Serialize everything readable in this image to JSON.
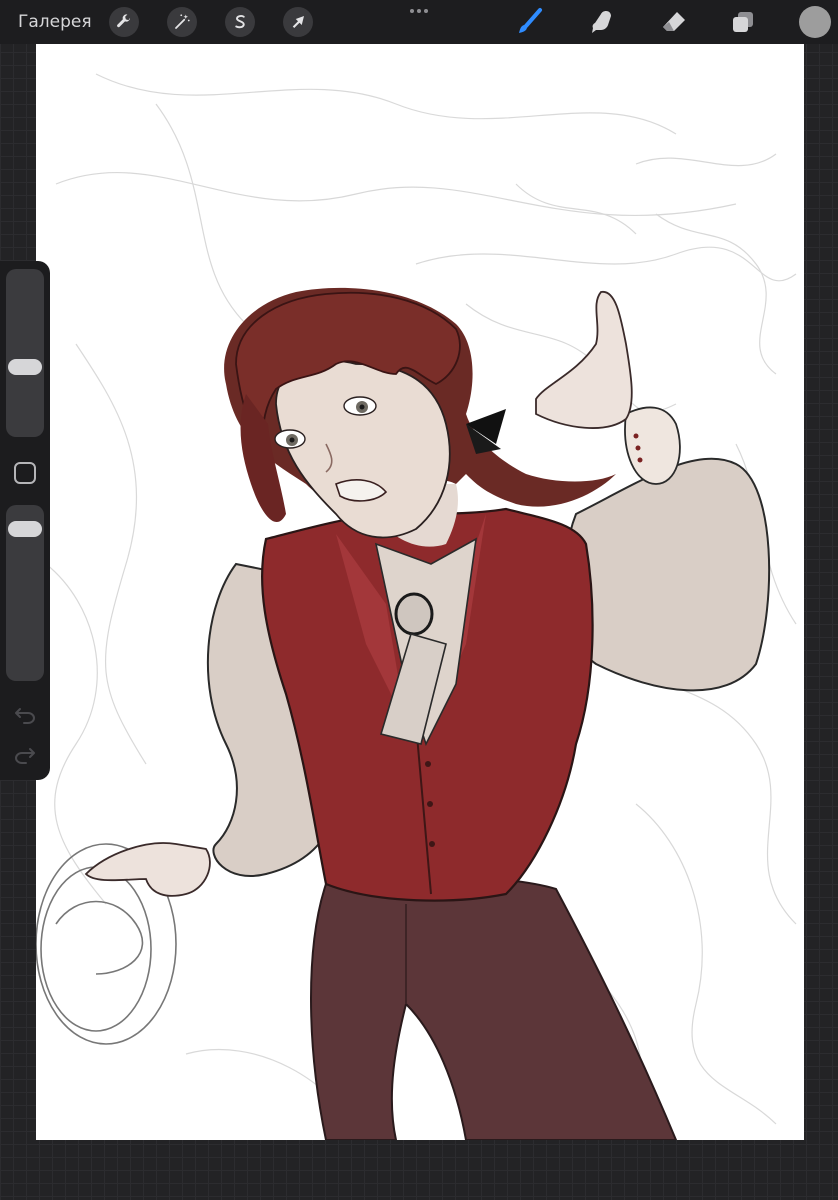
{
  "toolbar": {
    "gallery_label": "Галерея",
    "left_tools": [
      {
        "name": "actions",
        "icon": "wrench-icon"
      },
      {
        "name": "adjustments",
        "icon": "magic-wand-icon"
      },
      {
        "name": "selection",
        "icon": "selection-s-icon"
      },
      {
        "name": "transform",
        "icon": "arrow-cursor-icon"
      }
    ],
    "more_icon": "more-dots-icon",
    "right_tools": [
      {
        "name": "brush",
        "icon": "brush-icon",
        "active": true
      },
      {
        "name": "smudge",
        "icon": "smudge-finger-icon",
        "active": false
      },
      {
        "name": "eraser",
        "icon": "eraser-icon",
        "active": false
      },
      {
        "name": "layers",
        "icon": "layers-icon",
        "active": false
      }
    ],
    "current_color": "#9d9d9d",
    "accent_color": "#2f8cff"
  },
  "sidebar": {
    "brush_size_level": 0.4,
    "opacity_level": 0.92,
    "modify_button_icon": "square-modify-icon",
    "undo_icon": "undo-arrow-icon",
    "redo_icon": "redo-arrow-icon"
  },
  "canvas": {
    "background": "#ffffff",
    "artwork": "artwork-illustration"
  }
}
